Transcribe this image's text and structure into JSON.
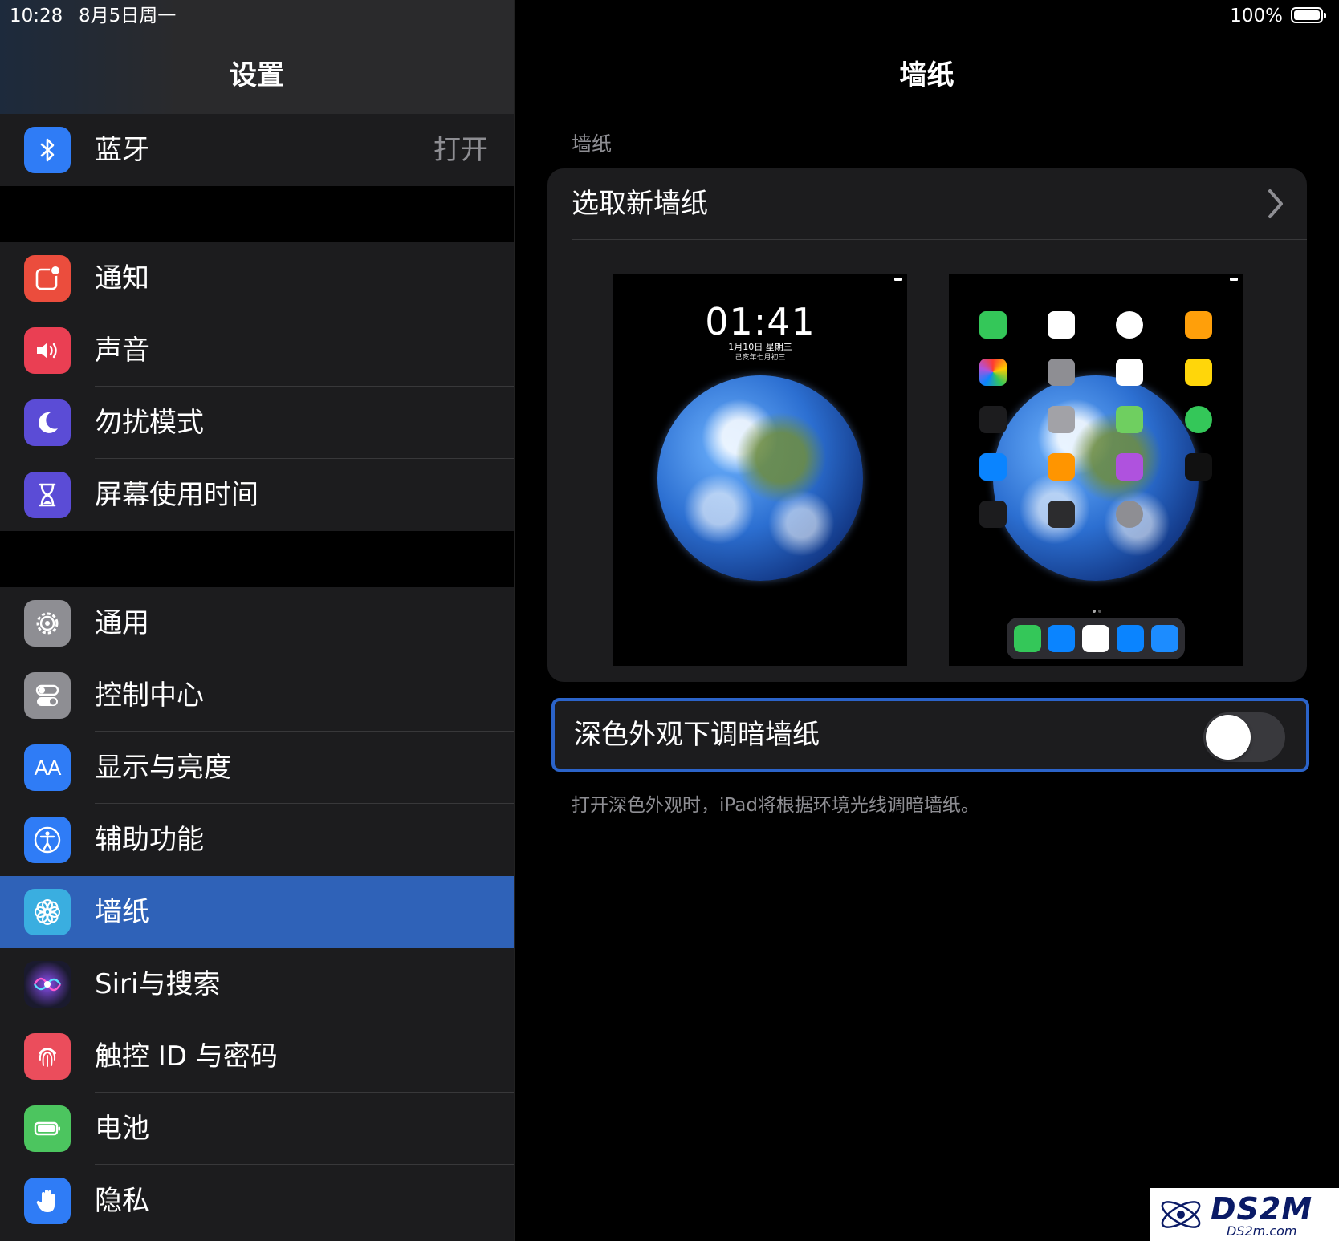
{
  "status_bar": {
    "time": "10:28",
    "date": "8月5日周一",
    "battery": "100%"
  },
  "sidebar": {
    "title": "设置",
    "groups": [
      {
        "items": [
          {
            "label": "蓝牙",
            "value": "打开",
            "icon": "bluetooth-icon",
            "color": "#2f7cf6"
          }
        ]
      },
      {
        "items": [
          {
            "label": "通知",
            "icon": "notifications-icon",
            "color": "#eb4d3d"
          },
          {
            "label": "声音",
            "icon": "speaker-icon",
            "color": "#ea3f53"
          },
          {
            "label": "勿扰模式",
            "icon": "moon-icon",
            "color": "#5b4cd6"
          },
          {
            "label": "屏幕使用时间",
            "icon": "hourglass-icon",
            "color": "#5b4cd6"
          }
        ]
      },
      {
        "items": [
          {
            "label": "通用",
            "icon": "gear-icon",
            "color": "#8e8e93"
          },
          {
            "label": "控制中心",
            "icon": "toggles-icon",
            "color": "#8e8e93"
          },
          {
            "label": "显示与亮度",
            "icon": "display-aa-icon",
            "color": "#2f7cf6"
          },
          {
            "label": "辅助功能",
            "icon": "accessibility-icon",
            "color": "#2f7cf6"
          },
          {
            "label": "墙纸",
            "icon": "wallpaper-flower-icon",
            "color": "#3aaee0",
            "selected": true
          },
          {
            "label": "Siri与搜索",
            "icon": "siri-icon",
            "color": "#1a1a2e"
          },
          {
            "label": "触控 ID 与密码",
            "icon": "fingerprint-icon",
            "color": "#eb4d5c"
          },
          {
            "label": "电池",
            "icon": "battery-icon",
            "color": "#4cc55f"
          },
          {
            "label": "隐私",
            "icon": "hand-icon",
            "color": "#2f7cf6"
          }
        ]
      }
    ]
  },
  "detail": {
    "title": "墙纸",
    "section_header": "墙纸",
    "choose_label": "选取新墙纸",
    "lock_preview": {
      "time": "01:41",
      "date": "1月10日 星期三",
      "lunar": "己亥年七月初三"
    },
    "dim_toggle": {
      "label": "深色外观下调暗墙纸",
      "on": false
    },
    "footer": "打开深色外观时，iPad将根据环境光线调暗墙纸。"
  },
  "watermark": {
    "text": "DS2M",
    "sub": "DS2m.com"
  },
  "colors": {
    "accent": "#2f62b8",
    "focus_ring": "#2b63c9",
    "cell": "#1c1c1e"
  }
}
